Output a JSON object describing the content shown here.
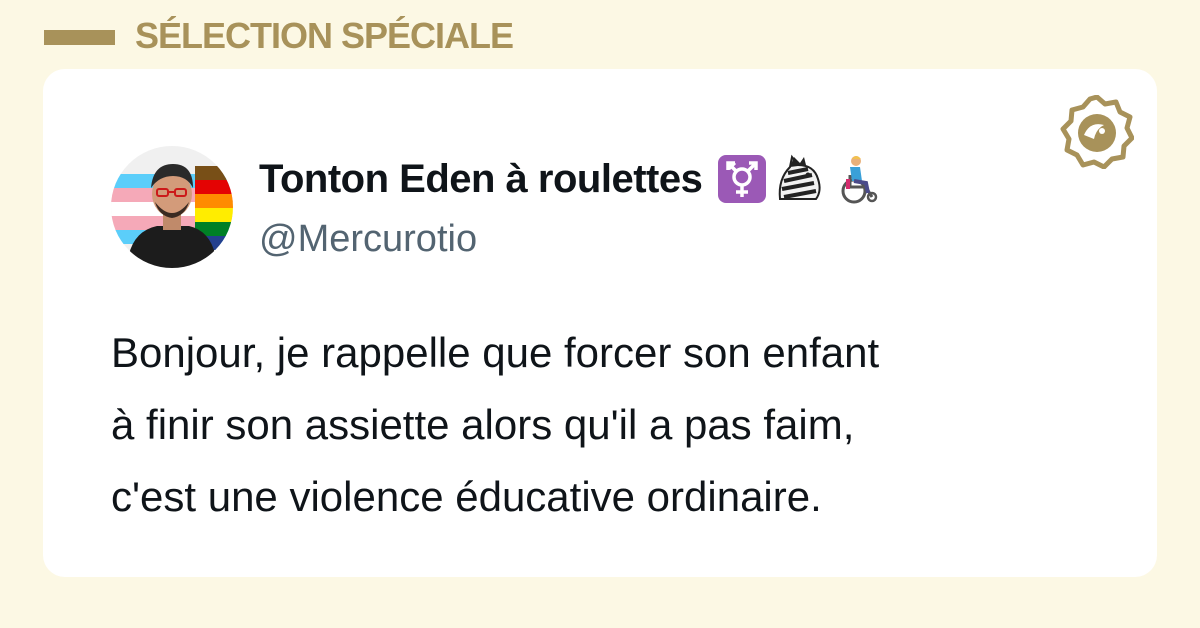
{
  "header": {
    "title": "SÉLECTION SPÉCIALE"
  },
  "colors": {
    "background": "#fcf8e4",
    "accent": "#a8925a",
    "card": "#ffffff",
    "text": "#0f1419",
    "handle": "#536471"
  },
  "brand": {
    "icon": "brand-logo-icon"
  },
  "tweet": {
    "author": {
      "display_name": "Tonton Eden à roulettes",
      "handle": "@Mercurotio",
      "avatar_icon": "user-avatar",
      "name_emojis": [
        "transgender-symbol-icon",
        "zebra-icon",
        "wheelchair-person-icon"
      ]
    },
    "lines": [
      "Bonjour, je rappelle que forcer son enfant",
      "à finir son assiette alors qu'il a pas faim,",
      "c'est une violence éducative ordinaire."
    ]
  }
}
